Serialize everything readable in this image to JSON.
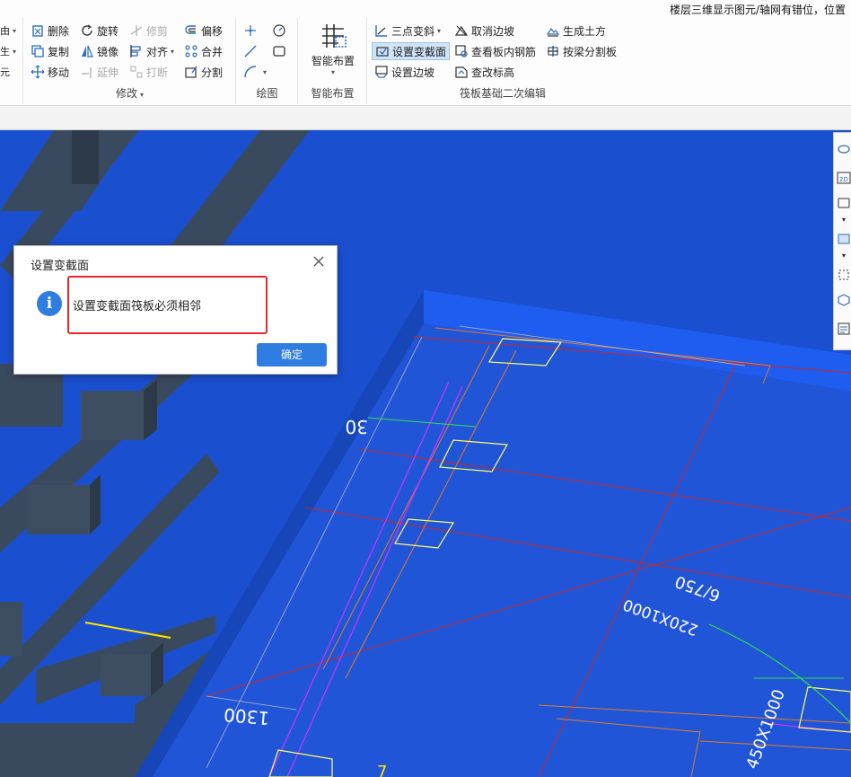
{
  "notice_text": "楼层三维显示图元/轴网有错位，位置",
  "ribbon": {
    "partial_group": {
      "items": [
        "",
        "",
        ""
      ]
    },
    "modify": {
      "label": "修改",
      "items": [
        "删除",
        "旋转",
        "修剪",
        "偏移",
        "复制",
        "镜像",
        "对齐",
        "合并",
        "移动",
        "延伸",
        "打断",
        "分割"
      ]
    },
    "draw": {
      "label": "绘图"
    },
    "smart": {
      "label": "智能布置",
      "button": "智能布置"
    },
    "raft": {
      "label": "筏板基础二次编辑",
      "items": [
        "三点变斜",
        "取消边坡",
        "生成土方",
        "设置变截面",
        "查看板内钢筋",
        "按梁分割板",
        "设置边坡",
        "查改标高"
      ]
    }
  },
  "dialog": {
    "title": "设置变截面",
    "message": "设置变截面筏板必须相邻",
    "ok_label": "确定"
  },
  "viewport": {
    "dim_30": "30",
    "dim_1300": "1300",
    "dim_6750": "6/750",
    "dim_220x1000": "220X1000",
    "dim_450x1000": "450X1000",
    "dim_7": "7"
  },
  "colors": {
    "background": "#1a4fd0",
    "raft": "#2155d8",
    "accent": "#2f7de0",
    "highlight": "#e8262a"
  }
}
